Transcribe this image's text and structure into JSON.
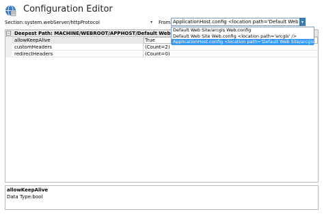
{
  "window": {
    "title": "Configuration Editor",
    "title_icon": "configuration-editor-icon"
  },
  "toolbar": {
    "section_label": "Section:",
    "section_value": "system.webServer/httpProtocol",
    "section_dropdown_glyph": "▾",
    "from_label": "From:",
    "from_value": "ApplicationHost.config <location path='Default Web Site/arcgi",
    "from_arrow_glyph": "▾"
  },
  "from_dropdown": {
    "options": [
      "Default Web Site/arcgis Web.config",
      "Default Web Site Web.config <location path='arcgis' />",
      "ApplicationHost.config <location path='Default Web Site/arcgis' />"
    ],
    "selected_index": 2
  },
  "grid": {
    "collapse_glyph": "−",
    "header": "Deepest Path: MACHINE/WEBROOT/APPHOST/Default Web Site/arcgis",
    "rows": [
      {
        "name": "allowKeepAlive",
        "value": "True"
      },
      {
        "name": "customHeaders",
        "value": "(Count=2)"
      },
      {
        "name": "redirectHeaders",
        "value": "(Count=0)"
      }
    ],
    "selected_row": 0,
    "value_dropdown_glyph": "▾"
  },
  "info": {
    "title": "allowKeepAlive",
    "data_type": "Data Type:bool"
  },
  "colors": {
    "selected_option_bg": "#3399ff",
    "combo_border": "#7a9cc8",
    "grid_header_bg": "#e6e6e6"
  }
}
